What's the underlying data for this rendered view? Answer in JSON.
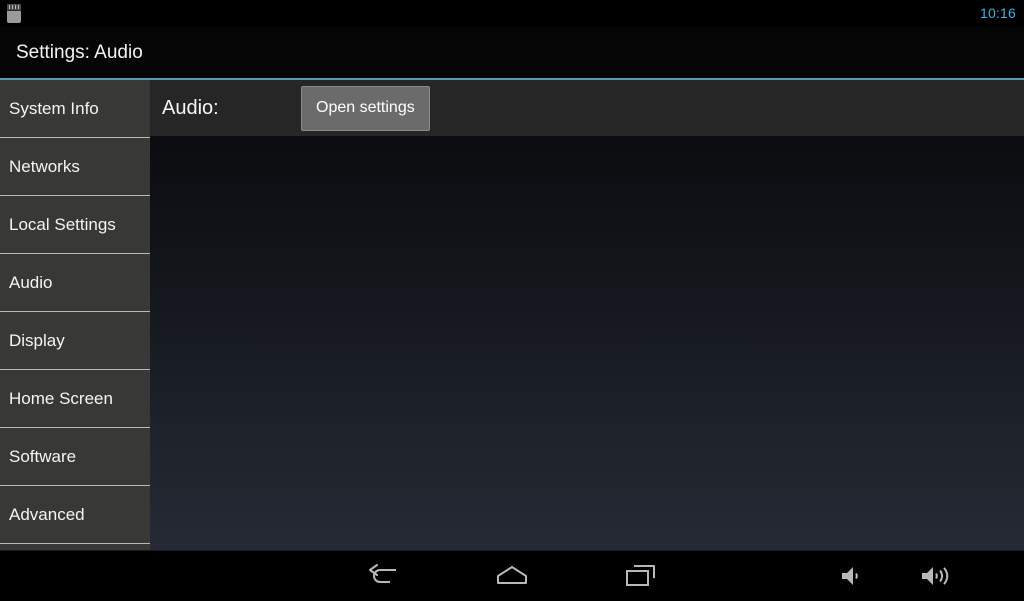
{
  "status_bar": {
    "icons": [
      {
        "name": "sd-card-icon",
        "label": "SD card"
      }
    ],
    "clock": "10:16",
    "clock_color": "#33b5e5",
    "background": "#000000"
  },
  "title_bar": {
    "title": "Settings: Audio",
    "accent_line_color": "#4f9cb0"
  },
  "sidebar": {
    "background": "#383836",
    "items": [
      {
        "label": "System Info",
        "selected": false
      },
      {
        "label": "Networks",
        "selected": false
      },
      {
        "label": "Local Settings",
        "selected": false
      },
      {
        "label": "Audio",
        "selected": false
      },
      {
        "label": "Display",
        "selected": false
      },
      {
        "label": "Home Screen",
        "selected": false
      },
      {
        "label": "Software",
        "selected": false
      },
      {
        "label": "Advanced",
        "selected": false
      }
    ]
  },
  "main": {
    "row": {
      "label": "Audio:",
      "button_label": "Open settings"
    }
  },
  "nav_bar": {
    "buttons": [
      {
        "name": "back-icon",
        "label": "Back"
      },
      {
        "name": "home-icon",
        "label": "Home"
      },
      {
        "name": "recents-icon",
        "label": "Recent apps"
      },
      {
        "name": "volume-down-icon",
        "label": "Volume down"
      },
      {
        "name": "volume-up-icon",
        "label": "Volume up"
      }
    ]
  }
}
